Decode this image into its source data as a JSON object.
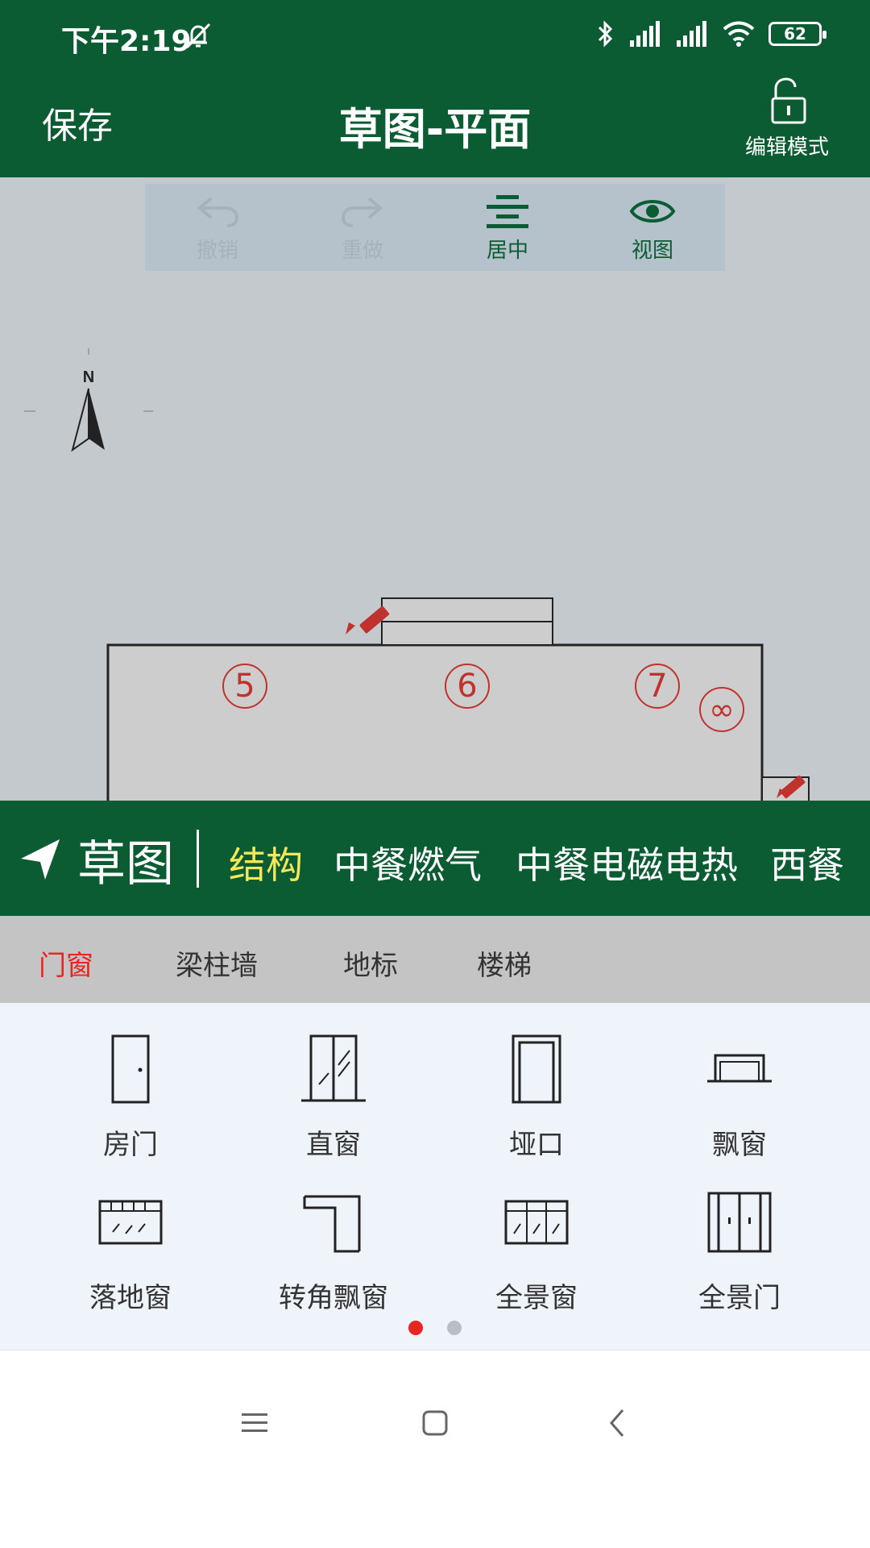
{
  "status_bar": {
    "time": "下午2:19",
    "battery": "62",
    "icons": [
      "silent-bell-icon",
      "bluetooth-icon",
      "signal-icon",
      "signal-icon",
      "wifi-icon",
      "battery-icon"
    ]
  },
  "header": {
    "save_label": "保存",
    "title": "草图-平面",
    "edit_mode_label": "编辑模式",
    "edit_mode_icon": "unlock-icon",
    "background": "#0b5b33"
  },
  "toolbar": {
    "undo": "撤销",
    "redo": "重做",
    "center": "居中",
    "view": "视图"
  },
  "compass": {
    "label": "N"
  },
  "floorplan": {
    "rooms": [
      "5",
      "6",
      "7",
      "∞"
    ]
  },
  "category_bar": {
    "main": "草图",
    "items": [
      "结构",
      "中餐燃气",
      "中餐电磁电热",
      "西餐"
    ],
    "active_index": 0,
    "active_color": "#f3e85a"
  },
  "subtabs": {
    "items": [
      "门窗",
      "梁柱墙",
      "地标",
      "楼梯"
    ],
    "active_index": 0,
    "active_color": "#e8261f"
  },
  "palette": {
    "items": [
      "房门",
      "直窗",
      "垭口",
      "飘窗",
      "落地窗",
      "转角飘窗",
      "全景窗",
      "全景门"
    ],
    "pages": 2,
    "active_page": 0
  },
  "navbar": {
    "icons": [
      "menu-icon",
      "home-icon",
      "back-icon"
    ]
  }
}
